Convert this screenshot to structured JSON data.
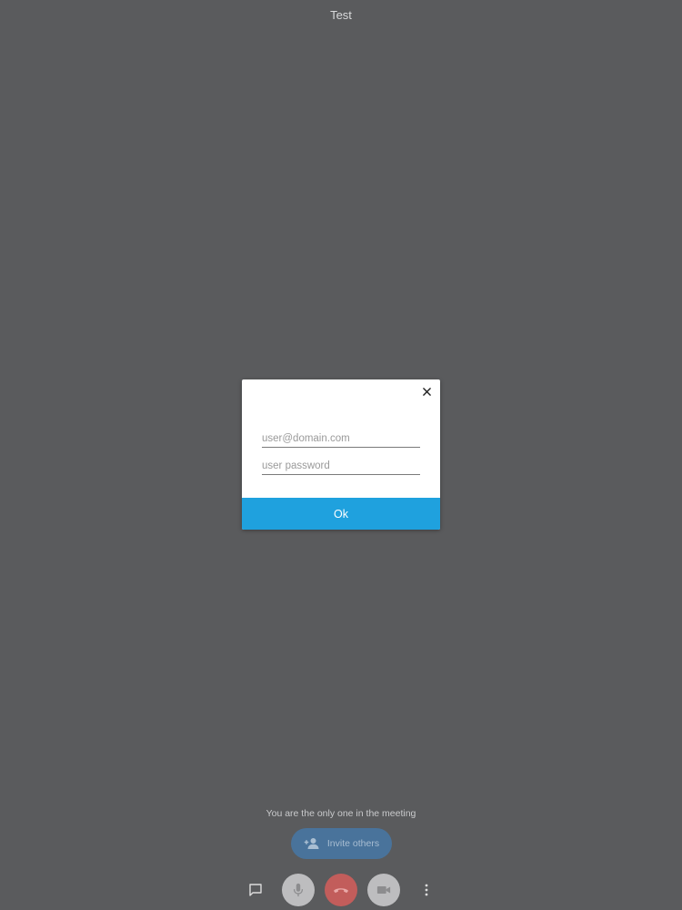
{
  "meeting": {
    "title": "Test"
  },
  "dialog": {
    "email_placeholder": "user@domain.com",
    "password_placeholder": "user password",
    "ok_label": "Ok"
  },
  "status": {
    "message": "You are the only one in the meeting"
  },
  "invite": {
    "label": "Invite others"
  },
  "toolbar": {
    "icons": [
      "chat-icon",
      "microphone-icon",
      "hangup-icon",
      "camera-icon",
      "more-vertical-icon"
    ]
  },
  "colors": {
    "background": "#5a5b5d",
    "ok_button": "#1fa1de",
    "invite_button": "#49739b",
    "hangup_button": "#c25d5b",
    "toolbar_button": "#bdbdbf"
  }
}
